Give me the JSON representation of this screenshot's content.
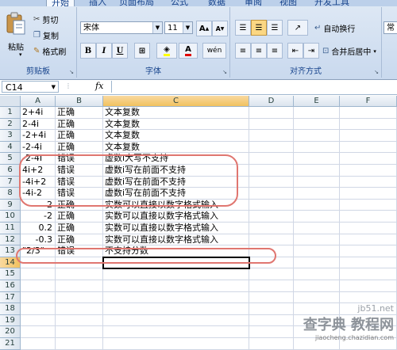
{
  "ribbon": {
    "tabs": [
      "开始",
      "插入",
      "页面布局",
      "公式",
      "数据",
      "审阅",
      "视图",
      "开发工具"
    ],
    "clipboard": {
      "cut": "剪切",
      "copy": "复制",
      "paste": "粘贴",
      "format_painter": "格式刷",
      "label": "剪贴板"
    },
    "font": {
      "name": "宋体",
      "size": "11",
      "bold": "B",
      "italic": "I",
      "underline": "U",
      "grow": "A",
      "shrink": "A",
      "font_color": "A",
      "phonetic": "wén",
      "label": "字体"
    },
    "alignment": {
      "wrap_text": "自动换行",
      "merge_center": "合并后居中",
      "label": "对齐方式"
    },
    "number": {
      "format": "常"
    }
  },
  "formula_bar": {
    "name_box": "C14",
    "fx": "fx",
    "content": ""
  },
  "sheet": {
    "columns": [
      "A",
      "B",
      "C",
      "D",
      "E",
      "F"
    ],
    "rows": [
      {
        "n": "1",
        "a": "2+4i",
        "a_align": "left",
        "b": "正确",
        "c": "文本复数"
      },
      {
        "n": "2",
        "a": "2-4i",
        "a_align": "left",
        "b": "正确",
        "c": "文本复数"
      },
      {
        "n": "3",
        "a": "-2+4i",
        "a_align": "left",
        "b": "正确",
        "c": "文本复数"
      },
      {
        "n": "4",
        "a": "-2-4i",
        "a_align": "left",
        "b": "正确",
        "c": "文本复数"
      },
      {
        "n": "5",
        "a": "-2-4I",
        "a_align": "left",
        "b": "错误",
        "c": "虚数i大写不支持"
      },
      {
        "n": "6",
        "a": "4i+2",
        "a_align": "left",
        "b": "错误",
        "c": "虚数i写在前面不支持"
      },
      {
        "n": "7",
        "a": "-4i+2",
        "a_align": "left",
        "b": "错误",
        "c": "虚数i写在前面不支持"
      },
      {
        "n": "8",
        "a": "-4i-2",
        "a_align": "left",
        "b": "错误",
        "c": "虚数i写在前面不支持"
      },
      {
        "n": "9",
        "a": "2",
        "a_align": "right",
        "b": "正确",
        "c": "实数可以直接以数字格式输入"
      },
      {
        "n": "10",
        "a": "-2",
        "a_align": "right",
        "b": "正确",
        "c": "实数可以直接以数字格式输入"
      },
      {
        "n": "11",
        "a": "0.2",
        "a_align": "right",
        "b": "正确",
        "c": "实数可以直接以数字格式输入"
      },
      {
        "n": "12",
        "a": "-0.3",
        "a_align": "right",
        "b": "正确",
        "c": "实数可以直接以数字格式输入"
      },
      {
        "n": "13",
        "a": "\"2/3\"",
        "a_align": "left",
        "b": "错误",
        "c": "不支持分数"
      },
      {
        "n": "14",
        "a": "",
        "a_align": "left",
        "b": "",
        "c": ""
      },
      {
        "n": "15",
        "a": "",
        "a_align": "left",
        "b": "",
        "c": ""
      },
      {
        "n": "16",
        "a": "",
        "a_align": "left",
        "b": "",
        "c": ""
      },
      {
        "n": "17",
        "a": "",
        "a_align": "left",
        "b": "",
        "c": ""
      },
      {
        "n": "18",
        "a": "",
        "a_align": "left",
        "b": "",
        "c": ""
      },
      {
        "n": "19",
        "a": "",
        "a_align": "left",
        "b": "",
        "c": ""
      },
      {
        "n": "20",
        "a": "",
        "a_align": "left",
        "b": "",
        "c": ""
      },
      {
        "n": "21",
        "a": "",
        "a_align": "left",
        "b": "",
        "c": ""
      }
    ],
    "selected_cell": "C14",
    "annotation_color": "#e07670"
  },
  "watermark": {
    "site": "jb51.net",
    "brand": "查字典 教程网",
    "url": "jiaocheng.chazidian.com"
  }
}
